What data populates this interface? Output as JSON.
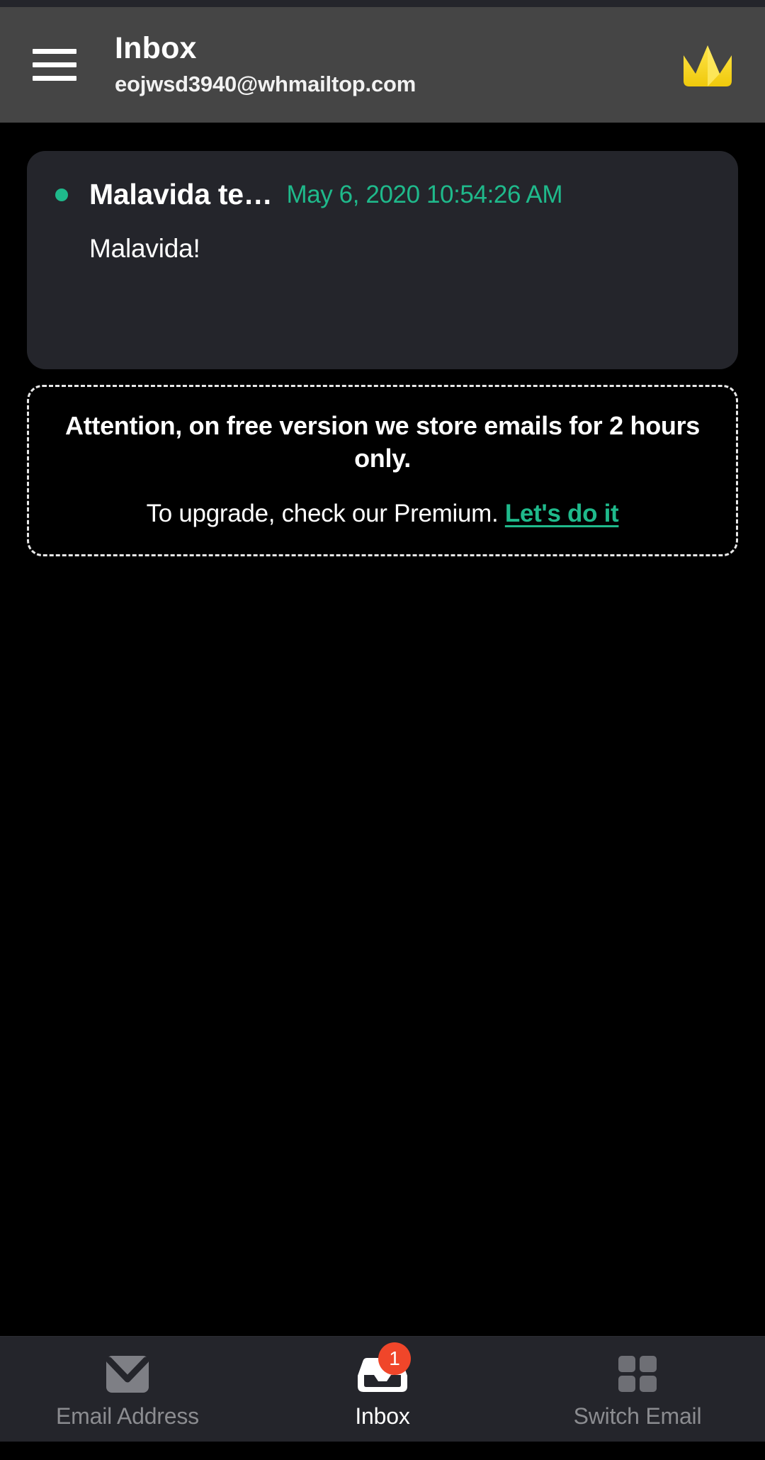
{
  "app": {
    "theme": "dark",
    "colors": {
      "background": "#000000",
      "header": "#454545",
      "card": "#24252B",
      "accent_teal": "#1FB98B",
      "badge_red": "#F0462A",
      "crown_gold": "#F4D21B",
      "text_primary": "#FFFFFF",
      "text_muted": "#8B8C90"
    }
  },
  "header": {
    "menu_icon": "hamburger-menu-icon",
    "title": "Inbox",
    "email_address": "eojwsd3940@whmailtop.com",
    "premium_icon": "crown-icon"
  },
  "inbox": {
    "emails": [
      {
        "unread": true,
        "sender": "Malavida te…",
        "date": "May 6, 2020 10:54:26 AM",
        "preview": "Malavida!"
      }
    ]
  },
  "notice": {
    "headline": "Attention, on free version we store emails for 2 hours only.",
    "sub_text": "To upgrade, check our Premium.",
    "link_label": "Let's do it"
  },
  "bottom_nav": {
    "items": [
      {
        "label": "Email Address",
        "icon": "envelope-icon",
        "active": false,
        "badge": ""
      },
      {
        "label": "Inbox",
        "icon": "inbox-tray-icon",
        "active": true,
        "badge": "1"
      },
      {
        "label": "Switch Email",
        "icon": "grid-squares-icon",
        "active": false,
        "badge": ""
      }
    ]
  }
}
